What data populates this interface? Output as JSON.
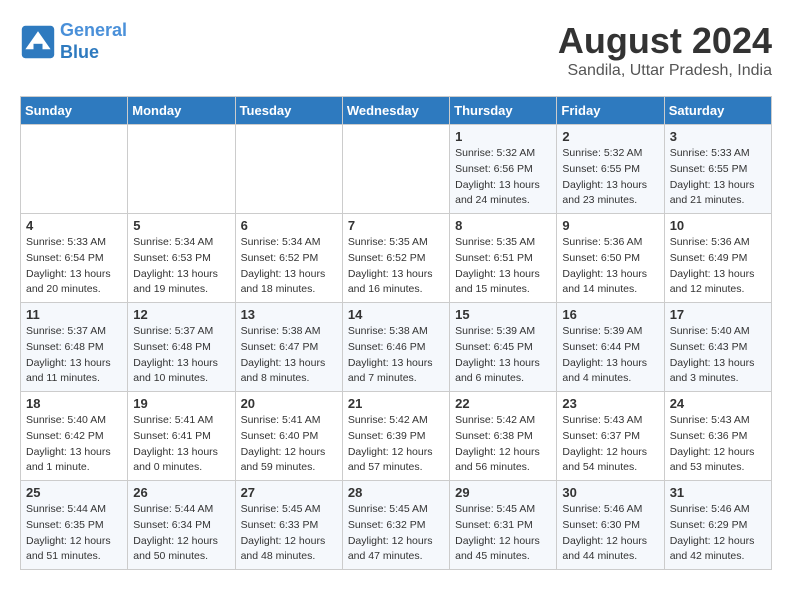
{
  "logo": {
    "line1": "General",
    "line2": "Blue"
  },
  "title": "August 2024",
  "location": "Sandila, Uttar Pradesh, India",
  "days_of_week": [
    "Sunday",
    "Monday",
    "Tuesday",
    "Wednesday",
    "Thursday",
    "Friday",
    "Saturday"
  ],
  "weeks": [
    [
      {
        "day": "",
        "info": ""
      },
      {
        "day": "",
        "info": ""
      },
      {
        "day": "",
        "info": ""
      },
      {
        "day": "",
        "info": ""
      },
      {
        "day": "1",
        "info": "Sunrise: 5:32 AM\nSunset: 6:56 PM\nDaylight: 13 hours and 24 minutes."
      },
      {
        "day": "2",
        "info": "Sunrise: 5:32 AM\nSunset: 6:55 PM\nDaylight: 13 hours and 23 minutes."
      },
      {
        "day": "3",
        "info": "Sunrise: 5:33 AM\nSunset: 6:55 PM\nDaylight: 13 hours and 21 minutes."
      }
    ],
    [
      {
        "day": "4",
        "info": "Sunrise: 5:33 AM\nSunset: 6:54 PM\nDaylight: 13 hours and 20 minutes."
      },
      {
        "day": "5",
        "info": "Sunrise: 5:34 AM\nSunset: 6:53 PM\nDaylight: 13 hours and 19 minutes."
      },
      {
        "day": "6",
        "info": "Sunrise: 5:34 AM\nSunset: 6:52 PM\nDaylight: 13 hours and 18 minutes."
      },
      {
        "day": "7",
        "info": "Sunrise: 5:35 AM\nSunset: 6:52 PM\nDaylight: 13 hours and 16 minutes."
      },
      {
        "day": "8",
        "info": "Sunrise: 5:35 AM\nSunset: 6:51 PM\nDaylight: 13 hours and 15 minutes."
      },
      {
        "day": "9",
        "info": "Sunrise: 5:36 AM\nSunset: 6:50 PM\nDaylight: 13 hours and 14 minutes."
      },
      {
        "day": "10",
        "info": "Sunrise: 5:36 AM\nSunset: 6:49 PM\nDaylight: 13 hours and 12 minutes."
      }
    ],
    [
      {
        "day": "11",
        "info": "Sunrise: 5:37 AM\nSunset: 6:48 PM\nDaylight: 13 hours and 11 minutes."
      },
      {
        "day": "12",
        "info": "Sunrise: 5:37 AM\nSunset: 6:48 PM\nDaylight: 13 hours and 10 minutes."
      },
      {
        "day": "13",
        "info": "Sunrise: 5:38 AM\nSunset: 6:47 PM\nDaylight: 13 hours and 8 minutes."
      },
      {
        "day": "14",
        "info": "Sunrise: 5:38 AM\nSunset: 6:46 PM\nDaylight: 13 hours and 7 minutes."
      },
      {
        "day": "15",
        "info": "Sunrise: 5:39 AM\nSunset: 6:45 PM\nDaylight: 13 hours and 6 minutes."
      },
      {
        "day": "16",
        "info": "Sunrise: 5:39 AM\nSunset: 6:44 PM\nDaylight: 13 hours and 4 minutes."
      },
      {
        "day": "17",
        "info": "Sunrise: 5:40 AM\nSunset: 6:43 PM\nDaylight: 13 hours and 3 minutes."
      }
    ],
    [
      {
        "day": "18",
        "info": "Sunrise: 5:40 AM\nSunset: 6:42 PM\nDaylight: 13 hours and 1 minute."
      },
      {
        "day": "19",
        "info": "Sunrise: 5:41 AM\nSunset: 6:41 PM\nDaylight: 13 hours and 0 minutes."
      },
      {
        "day": "20",
        "info": "Sunrise: 5:41 AM\nSunset: 6:40 PM\nDaylight: 12 hours and 59 minutes."
      },
      {
        "day": "21",
        "info": "Sunrise: 5:42 AM\nSunset: 6:39 PM\nDaylight: 12 hours and 57 minutes."
      },
      {
        "day": "22",
        "info": "Sunrise: 5:42 AM\nSunset: 6:38 PM\nDaylight: 12 hours and 56 minutes."
      },
      {
        "day": "23",
        "info": "Sunrise: 5:43 AM\nSunset: 6:37 PM\nDaylight: 12 hours and 54 minutes."
      },
      {
        "day": "24",
        "info": "Sunrise: 5:43 AM\nSunset: 6:36 PM\nDaylight: 12 hours and 53 minutes."
      }
    ],
    [
      {
        "day": "25",
        "info": "Sunrise: 5:44 AM\nSunset: 6:35 PM\nDaylight: 12 hours and 51 minutes."
      },
      {
        "day": "26",
        "info": "Sunrise: 5:44 AM\nSunset: 6:34 PM\nDaylight: 12 hours and 50 minutes."
      },
      {
        "day": "27",
        "info": "Sunrise: 5:45 AM\nSunset: 6:33 PM\nDaylight: 12 hours and 48 minutes."
      },
      {
        "day": "28",
        "info": "Sunrise: 5:45 AM\nSunset: 6:32 PM\nDaylight: 12 hours and 47 minutes."
      },
      {
        "day": "29",
        "info": "Sunrise: 5:45 AM\nSunset: 6:31 PM\nDaylight: 12 hours and 45 minutes."
      },
      {
        "day": "30",
        "info": "Sunrise: 5:46 AM\nSunset: 6:30 PM\nDaylight: 12 hours and 44 minutes."
      },
      {
        "day": "31",
        "info": "Sunrise: 5:46 AM\nSunset: 6:29 PM\nDaylight: 12 hours and 42 minutes."
      }
    ]
  ]
}
